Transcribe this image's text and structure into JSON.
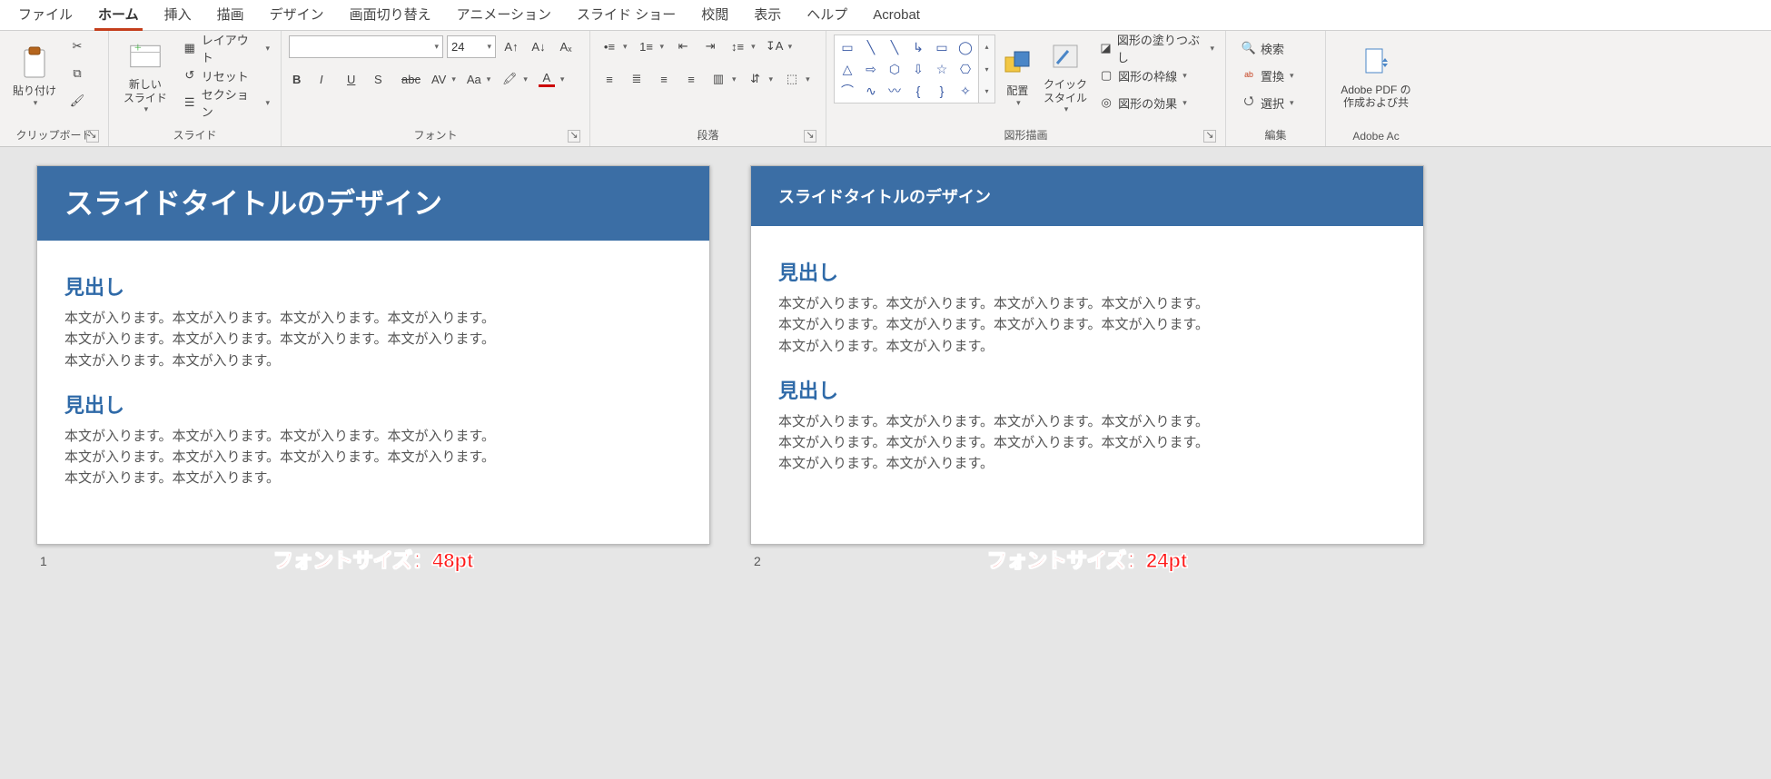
{
  "tabs": {
    "items": [
      "ファイル",
      "ホーム",
      "挿入",
      "描画",
      "デザイン",
      "画面切り替え",
      "アニメーション",
      "スライド ショー",
      "校閲",
      "表示",
      "ヘルプ",
      "Acrobat"
    ],
    "activeIndex": 1
  },
  "ribbon": {
    "clipboard": {
      "label": "クリップボード",
      "paste": "貼り付け"
    },
    "slides": {
      "label": "スライド",
      "newSlide": "新しい\nスライド",
      "layout": "レイアウト",
      "reset": "リセット",
      "section": "セクション"
    },
    "font": {
      "label": "フォント",
      "fontName": "",
      "fontSize": "24",
      "bold": "B",
      "italic": "I",
      "underline": "U",
      "shadow": "S",
      "strike": "abc",
      "spacing": "AV",
      "caseMenu": "Aa"
    },
    "paragraph": {
      "label": "段落"
    },
    "drawing": {
      "label": "図形描画",
      "arrange": "配置",
      "quick": "クイック\nスタイル",
      "fill": "図形の塗りつぶし",
      "outline": "図形の枠線",
      "effects": "図形の効果"
    },
    "editing": {
      "label": "編集",
      "find": "検索",
      "replace": "置換",
      "select": "選択"
    },
    "acrobat": {
      "label": "Adobe Ac",
      "create": "Adobe PDF の\n作成および共"
    }
  },
  "slides": [
    {
      "number": "1",
      "titleSize": "big",
      "title": "スライドタイトルのデザイン",
      "heading1": "見出し",
      "body1": "本文が入ります。本文が入ります。本文が入ります。本文が入ります。\n本文が入ります。本文が入ります。本文が入ります。本文が入ります。\n本文が入ります。本文が入ります。",
      "heading2": "見出し",
      "body2": "本文が入ります。本文が入ります。本文が入ります。本文が入ります。\n本文が入ります。本文が入ります。本文が入ります。本文が入ります。\n本文が入ります。本文が入ります。",
      "caption": "フォントサイズ：48pt"
    },
    {
      "number": "2",
      "titleSize": "small",
      "title": "スライドタイトルのデザイン",
      "heading1": "見出し",
      "body1": "本文が入ります。本文が入ります。本文が入ります。本文が入ります。\n本文が入ります。本文が入ります。本文が入ります。本文が入ります。\n本文が入ります。本文が入ります。",
      "heading2": "見出し",
      "body2": "本文が入ります。本文が入ります。本文が入ります。本文が入ります。\n本文が入ります。本文が入ります。本文が入ります。本文が入ります。\n本文が入ります。本文が入ります。",
      "caption": "フォントサイズ：24pt"
    }
  ]
}
